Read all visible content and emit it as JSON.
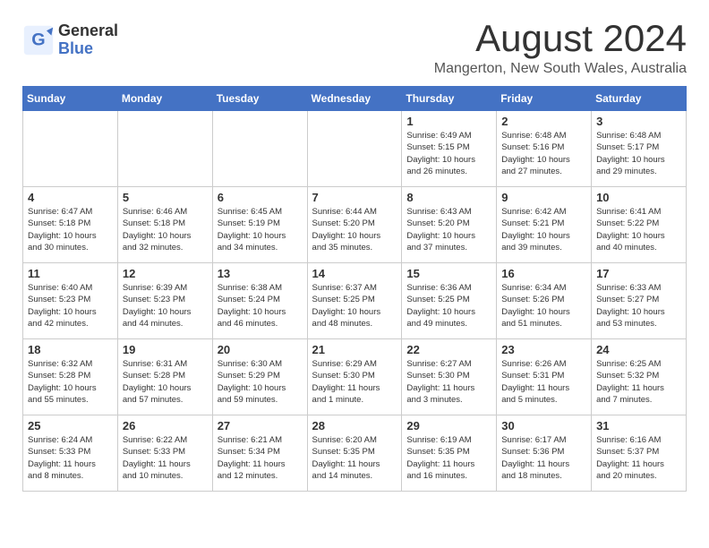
{
  "logo": {
    "general": "General",
    "blue": "Blue"
  },
  "header": {
    "month": "August 2024",
    "location": "Mangerton, New South Wales, Australia"
  },
  "columns": [
    "Sunday",
    "Monday",
    "Tuesday",
    "Wednesday",
    "Thursday",
    "Friday",
    "Saturday"
  ],
  "weeks": [
    [
      {
        "day": "",
        "info": ""
      },
      {
        "day": "",
        "info": ""
      },
      {
        "day": "",
        "info": ""
      },
      {
        "day": "",
        "info": ""
      },
      {
        "day": "1",
        "info": "Sunrise: 6:49 AM\nSunset: 5:15 PM\nDaylight: 10 hours\nand 26 minutes."
      },
      {
        "day": "2",
        "info": "Sunrise: 6:48 AM\nSunset: 5:16 PM\nDaylight: 10 hours\nand 27 minutes."
      },
      {
        "day": "3",
        "info": "Sunrise: 6:48 AM\nSunset: 5:17 PM\nDaylight: 10 hours\nand 29 minutes."
      }
    ],
    [
      {
        "day": "4",
        "info": "Sunrise: 6:47 AM\nSunset: 5:18 PM\nDaylight: 10 hours\nand 30 minutes."
      },
      {
        "day": "5",
        "info": "Sunrise: 6:46 AM\nSunset: 5:18 PM\nDaylight: 10 hours\nand 32 minutes."
      },
      {
        "day": "6",
        "info": "Sunrise: 6:45 AM\nSunset: 5:19 PM\nDaylight: 10 hours\nand 34 minutes."
      },
      {
        "day": "7",
        "info": "Sunrise: 6:44 AM\nSunset: 5:20 PM\nDaylight: 10 hours\nand 35 minutes."
      },
      {
        "day": "8",
        "info": "Sunrise: 6:43 AM\nSunset: 5:20 PM\nDaylight: 10 hours\nand 37 minutes."
      },
      {
        "day": "9",
        "info": "Sunrise: 6:42 AM\nSunset: 5:21 PM\nDaylight: 10 hours\nand 39 minutes."
      },
      {
        "day": "10",
        "info": "Sunrise: 6:41 AM\nSunset: 5:22 PM\nDaylight: 10 hours\nand 40 minutes."
      }
    ],
    [
      {
        "day": "11",
        "info": "Sunrise: 6:40 AM\nSunset: 5:23 PM\nDaylight: 10 hours\nand 42 minutes."
      },
      {
        "day": "12",
        "info": "Sunrise: 6:39 AM\nSunset: 5:23 PM\nDaylight: 10 hours\nand 44 minutes."
      },
      {
        "day": "13",
        "info": "Sunrise: 6:38 AM\nSunset: 5:24 PM\nDaylight: 10 hours\nand 46 minutes."
      },
      {
        "day": "14",
        "info": "Sunrise: 6:37 AM\nSunset: 5:25 PM\nDaylight: 10 hours\nand 48 minutes."
      },
      {
        "day": "15",
        "info": "Sunrise: 6:36 AM\nSunset: 5:25 PM\nDaylight: 10 hours\nand 49 minutes."
      },
      {
        "day": "16",
        "info": "Sunrise: 6:34 AM\nSunset: 5:26 PM\nDaylight: 10 hours\nand 51 minutes."
      },
      {
        "day": "17",
        "info": "Sunrise: 6:33 AM\nSunset: 5:27 PM\nDaylight: 10 hours\nand 53 minutes."
      }
    ],
    [
      {
        "day": "18",
        "info": "Sunrise: 6:32 AM\nSunset: 5:28 PM\nDaylight: 10 hours\nand 55 minutes."
      },
      {
        "day": "19",
        "info": "Sunrise: 6:31 AM\nSunset: 5:28 PM\nDaylight: 10 hours\nand 57 minutes."
      },
      {
        "day": "20",
        "info": "Sunrise: 6:30 AM\nSunset: 5:29 PM\nDaylight: 10 hours\nand 59 minutes."
      },
      {
        "day": "21",
        "info": "Sunrise: 6:29 AM\nSunset: 5:30 PM\nDaylight: 11 hours\nand 1 minute."
      },
      {
        "day": "22",
        "info": "Sunrise: 6:27 AM\nSunset: 5:30 PM\nDaylight: 11 hours\nand 3 minutes."
      },
      {
        "day": "23",
        "info": "Sunrise: 6:26 AM\nSunset: 5:31 PM\nDaylight: 11 hours\nand 5 minutes."
      },
      {
        "day": "24",
        "info": "Sunrise: 6:25 AM\nSunset: 5:32 PM\nDaylight: 11 hours\nand 7 minutes."
      }
    ],
    [
      {
        "day": "25",
        "info": "Sunrise: 6:24 AM\nSunset: 5:33 PM\nDaylight: 11 hours\nand 8 minutes."
      },
      {
        "day": "26",
        "info": "Sunrise: 6:22 AM\nSunset: 5:33 PM\nDaylight: 11 hours\nand 10 minutes."
      },
      {
        "day": "27",
        "info": "Sunrise: 6:21 AM\nSunset: 5:34 PM\nDaylight: 11 hours\nand 12 minutes."
      },
      {
        "day": "28",
        "info": "Sunrise: 6:20 AM\nSunset: 5:35 PM\nDaylight: 11 hours\nand 14 minutes."
      },
      {
        "day": "29",
        "info": "Sunrise: 6:19 AM\nSunset: 5:35 PM\nDaylight: 11 hours\nand 16 minutes."
      },
      {
        "day": "30",
        "info": "Sunrise: 6:17 AM\nSunset: 5:36 PM\nDaylight: 11 hours\nand 18 minutes."
      },
      {
        "day": "31",
        "info": "Sunrise: 6:16 AM\nSunset: 5:37 PM\nDaylight: 11 hours\nand 20 minutes."
      }
    ]
  ]
}
